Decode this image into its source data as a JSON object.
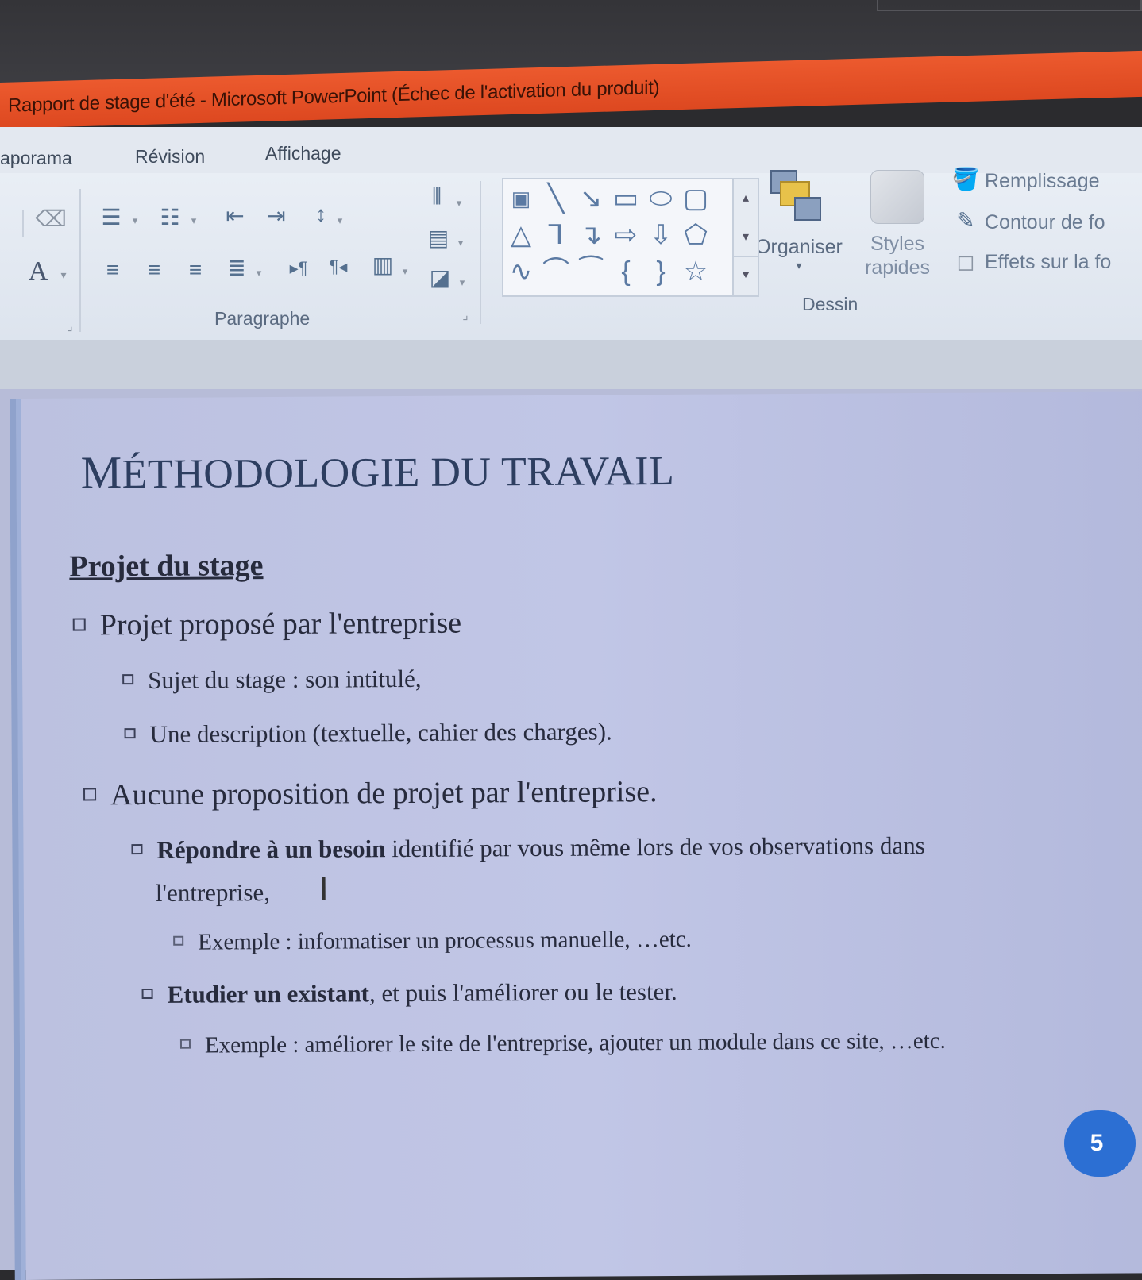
{
  "window": {
    "title": "Rapport de stage d'été - Microsoft PowerPoint (Échec de l'activation du produit)"
  },
  "menu": {
    "tabs": [
      "aporama",
      "Révision",
      "Affichage"
    ]
  },
  "ribbon": {
    "paragraph_group": "Paragraphe",
    "drawing_group": "Dessin",
    "organize_label": "Organiser",
    "styles_label_1": "Styles",
    "styles_label_2": "rapides",
    "fill_label": "Remplissage",
    "outline_label": "Contour de fo",
    "effects_label": "Effets sur la fo",
    "font_color_glyph": "A"
  },
  "slide": {
    "title_first": "M",
    "title_rest": "ÉTHODOLOGIE DU TRAVAIL",
    "section": "Projet du stage",
    "items": [
      {
        "text": "Projet proposé par l'entreprise"
      },
      {
        "text": "Sujet du stage : son intitulé,"
      },
      {
        "text": "Une description  (textuelle, cahier des charges)."
      },
      {
        "text": "Aucune proposition de projet  par l'entreprise."
      },
      {
        "bold": "Répondre à un besoin",
        "text": " identifié par vous même lors de vos observations dans"
      },
      {
        "text": "l'entreprise,"
      },
      {
        "text": "Exemple : informatiser un processus manuelle, …etc."
      },
      {
        "bold": "Etudier un existant",
        "text": ", et puis l'améliorer ou le tester."
      },
      {
        "text": "Exemple : améliorer le site  de l'entreprise, ajouter un module dans ce site,  …etc."
      }
    ],
    "page_number": "5"
  }
}
